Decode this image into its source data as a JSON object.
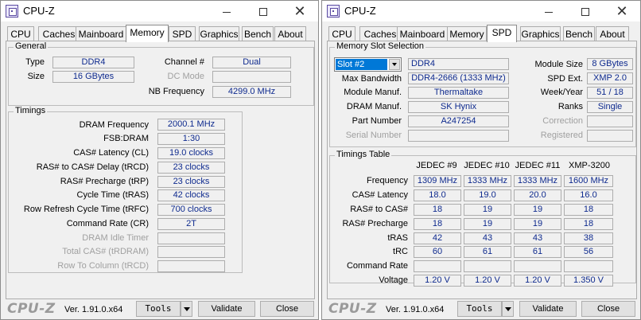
{
  "left_window": {
    "title": "CPU-Z",
    "tabs": [
      "CPU",
      "Caches",
      "Mainboard",
      "Memory",
      "SPD",
      "Graphics",
      "Bench",
      "About"
    ],
    "active_tab": "Memory",
    "general": {
      "title": "General",
      "type_label": "Type",
      "type_value": "DDR4",
      "size_label": "Size",
      "size_value": "16 GBytes",
      "channel_label": "Channel #",
      "channel_value": "Dual",
      "dcmode_label": "DC Mode",
      "dcmode_value": "",
      "nbfreq_label": "NB Frequency",
      "nbfreq_value": "4299.0 MHz"
    },
    "timings": {
      "title": "Timings",
      "rows": [
        {
          "label": "DRAM Frequency",
          "value": "2000.1 MHz",
          "disabled": false
        },
        {
          "label": "FSB:DRAM",
          "value": "1:30",
          "disabled": false
        },
        {
          "label": "CAS# Latency (CL)",
          "value": "19.0 clocks",
          "disabled": false
        },
        {
          "label": "RAS# to CAS# Delay (tRCD)",
          "value": "23 clocks",
          "disabled": false
        },
        {
          "label": "RAS# Precharge (tRP)",
          "value": "23 clocks",
          "disabled": false
        },
        {
          "label": "Cycle Time (tRAS)",
          "value": "42 clocks",
          "disabled": false
        },
        {
          "label": "Row Refresh Cycle Time (tRFC)",
          "value": "700 clocks",
          "disabled": false
        },
        {
          "label": "Command Rate (CR)",
          "value": "2T",
          "disabled": false
        },
        {
          "label": "DRAM Idle Timer",
          "value": "",
          "disabled": true
        },
        {
          "label": "Total CAS# (tRDRAM)",
          "value": "",
          "disabled": true
        },
        {
          "label": "Row To Column (tRCD)",
          "value": "",
          "disabled": true
        }
      ]
    }
  },
  "right_window": {
    "title": "CPU-Z",
    "tabs": [
      "CPU",
      "Caches",
      "Mainboard",
      "Memory",
      "SPD",
      "Graphics",
      "Bench",
      "About"
    ],
    "active_tab": "SPD",
    "slot": {
      "title": "Memory Slot Selection",
      "selected": "Slot #2",
      "type_value": "DDR4",
      "module_size_label": "Module Size",
      "module_size_value": "8 GBytes",
      "max_bw_label": "Max Bandwidth",
      "max_bw_value": "DDR4-2666 (1333 MHz)",
      "spd_ext_label": "SPD Ext.",
      "spd_ext_value": "XMP 2.0",
      "module_manuf_label": "Module Manuf.",
      "module_manuf_value": "Thermaltake",
      "week_year_label": "Week/Year",
      "week_year_value": "51 / 18",
      "dram_manuf_label": "DRAM Manuf.",
      "dram_manuf_value": "SK Hynix",
      "ranks_label": "Ranks",
      "ranks_value": "Single",
      "part_label": "Part Number",
      "part_value": "A247254",
      "correction_label": "Correction",
      "correction_value": "",
      "serial_label": "Serial Number",
      "serial_value": "",
      "registered_label": "Registered",
      "registered_value": ""
    },
    "timings_table": {
      "title": "Timings Table",
      "columns": [
        "JEDEC #9",
        "JEDEC #10",
        "JEDEC #11",
        "XMP-3200"
      ],
      "rows": [
        {
          "label": "Frequency",
          "values": [
            "1309 MHz",
            "1333 MHz",
            "1333 MHz",
            "1600 MHz"
          ]
        },
        {
          "label": "CAS# Latency",
          "values": [
            "18.0",
            "19.0",
            "20.0",
            "16.0"
          ]
        },
        {
          "label": "RAS# to CAS#",
          "values": [
            "18",
            "19",
            "19",
            "18"
          ]
        },
        {
          "label": "RAS# Precharge",
          "values": [
            "18",
            "19",
            "19",
            "18"
          ]
        },
        {
          "label": "tRAS",
          "values": [
            "42",
            "43",
            "43",
            "38"
          ]
        },
        {
          "label": "tRC",
          "values": [
            "60",
            "61",
            "61",
            "56"
          ]
        },
        {
          "label": "Command Rate",
          "values": [
            "",
            "",
            "",
            ""
          ]
        },
        {
          "label": "Voltage",
          "values": [
            "1.20 V",
            "1.20 V",
            "1.20 V",
            "1.350 V"
          ]
        }
      ]
    }
  },
  "footer": {
    "brand": "CPU-Z",
    "version": "Ver. 1.91.0.x64",
    "tools_label": "Tools",
    "validate_label": "Validate",
    "close_label": "Close"
  }
}
